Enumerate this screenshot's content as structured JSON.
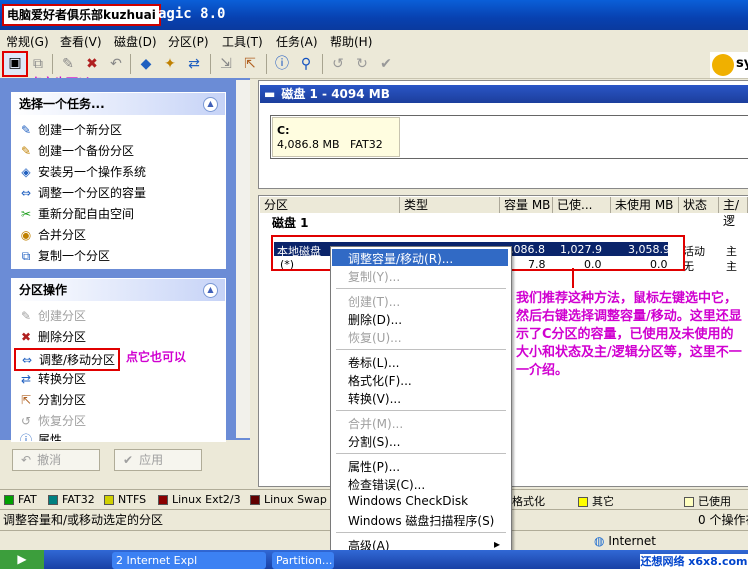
{
  "window": {
    "badge": "电脑爱好者俱乐部kuzhuai",
    "title_tail": "agic 8.0"
  },
  "menu": [
    "常规(G)",
    "查看(V)",
    "磁盘(D)",
    "分区(P)",
    "工具(T)",
    "任务(A)",
    "帮助(H)"
  ],
  "toolbar_hint": "点它也可以",
  "tasks": {
    "header": "选择一个任务...",
    "items": [
      "创建一个新分区",
      "创建一个备份分区",
      "安装另一个操作系统",
      "调整一个分区的容量",
      "重新分配自由空间",
      "合并分区",
      "复制一个分区"
    ]
  },
  "partition_ops": {
    "header": "分区操作",
    "items": [
      "创建分区",
      "删除分区",
      "调整/移动分区",
      "转换分区",
      "分割分区",
      "恢复分区",
      "属性"
    ],
    "hint": "点它也可以"
  },
  "buttons": {
    "undo": "撤消",
    "apply": "应用"
  },
  "disk": {
    "header": "磁盘 1 - 4094 MB",
    "partition_name": "C:",
    "partition_info": "4,086.8 MB   FAT32"
  },
  "table": {
    "columns": [
      "分区",
      "类型",
      "容量 MB",
      "已使...",
      "未使用 MB",
      "状态",
      "主/逻"
    ],
    "group": "磁盘 1",
    "rows": [
      {
        "name": "本地磁盘",
        "size": ",086.8",
        "used": "1,027.9",
        "unused": "3,058.9",
        "status": "活动",
        "kind": "主"
      },
      {
        "name": "(*)",
        "size": "7.8",
        "used": "0.0",
        "unused": "0.0",
        "status": "无",
        "kind": "主"
      }
    ]
  },
  "context_menu": [
    {
      "label": "调整容量/移动(R)...",
      "enabled": true,
      "highlight": true
    },
    {
      "label": "复制(Y)...",
      "enabled": false
    },
    {
      "sep": true
    },
    {
      "label": "创建(T)...",
      "enabled": false
    },
    {
      "label": "删除(D)...",
      "enabled": true
    },
    {
      "label": "恢复(U)...",
      "enabled": false
    },
    {
      "sep": true
    },
    {
      "label": "卷标(L)...",
      "enabled": true
    },
    {
      "label": "格式化(F)...",
      "enabled": true
    },
    {
      "label": "转换(V)...",
      "enabled": true
    },
    {
      "sep": true
    },
    {
      "label": "合并(M)...",
      "enabled": false
    },
    {
      "label": "分割(S)...",
      "enabled": true
    },
    {
      "sep": true
    },
    {
      "label": "属性(P)...",
      "enabled": true
    },
    {
      "label": "检查错误(C)...",
      "enabled": true
    },
    {
      "label": "Windows CheckDisk",
      "enabled": true
    },
    {
      "label": "Windows 磁盘扫描程序(S)",
      "enabled": true
    },
    {
      "sep": true
    },
    {
      "label": "高级(A)",
      "enabled": true
    }
  ],
  "annotation": "我们推荐这种方法，鼠标左键选中它，然后右键选择调整容量/移动。这里还显示了C分区的容量，已使用及未使用的大小和状态及主/逻辑分区等，这里不一一介绍。",
  "legend": [
    "FAT",
    "FAT32",
    "NTFS",
    "Linux Ext2/3",
    "Linux Swap",
    "格式化",
    "其它",
    "已使用"
  ],
  "legend_colors": [
    "#00a000",
    "#008080",
    "#d0d000",
    "#8b0000",
    "#600000",
    "#ffffff",
    "#ffff00",
    "#ffffc0"
  ],
  "status": {
    "message": "调整容量和/或移动选定的分区",
    "ops": "0 个操作在"
  },
  "taskbar": {
    "items": [
      "2 Internet Expl",
      "Partition..."
    ],
    "tray": "Internet",
    "watermark": "还想网络 x6x8.com"
  }
}
